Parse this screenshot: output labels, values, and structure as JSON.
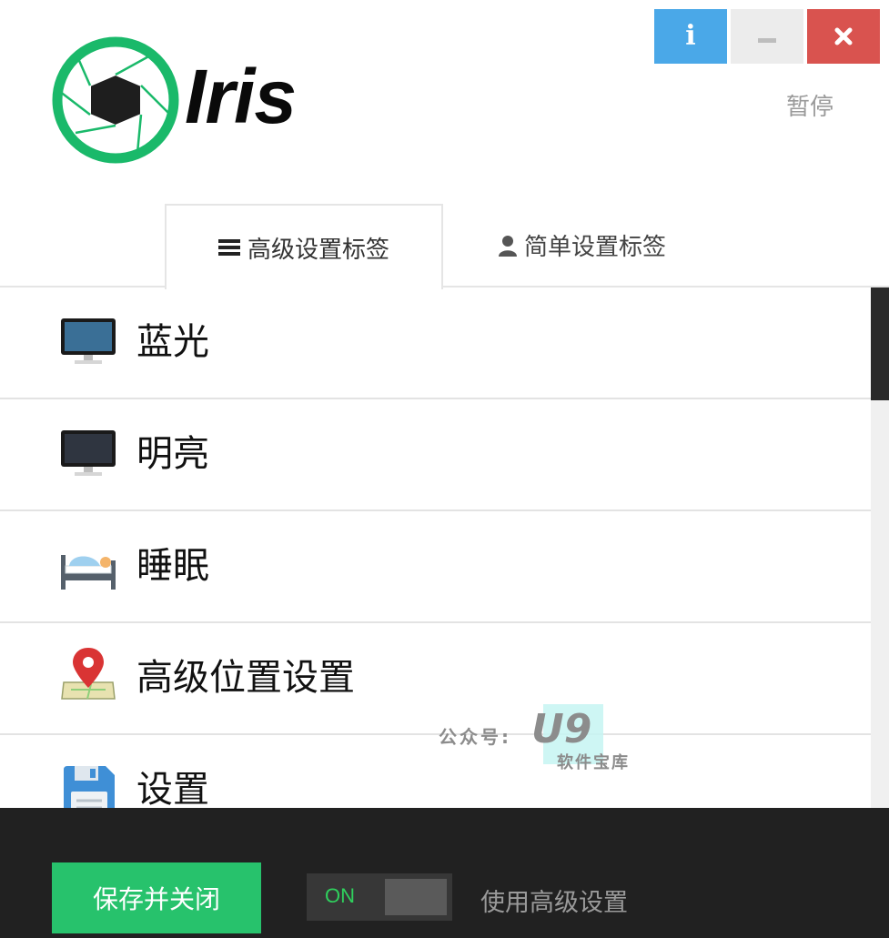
{
  "window": {
    "info_label": "i",
    "pause_label": "暂停"
  },
  "logo": {
    "text": "Iris",
    "ring_color": "#1ab96a"
  },
  "tabs": [
    {
      "label": "高级设置标签",
      "icon": "menu-icon",
      "active": true
    },
    {
      "label": "简单设置标签",
      "icon": "user-icon",
      "active": false
    }
  ],
  "settings_items": [
    {
      "label": "蓝光",
      "icon": "monitor-blue-icon"
    },
    {
      "label": "明亮",
      "icon": "monitor-dark-icon"
    },
    {
      "label": "睡眠",
      "icon": "bed-icon"
    },
    {
      "label": "高级位置设置",
      "icon": "map-pin-icon"
    },
    {
      "label": "设置",
      "icon": "floppy-disk-icon"
    }
  ],
  "watermark": {
    "prefix": "公众号:",
    "brand": "U9",
    "sub": "软件宝库"
  },
  "footer": {
    "save_label": "保存并关闭",
    "toggle_state": "ON",
    "advanced_label": "使用高级设置"
  },
  "colors": {
    "info": "#4aa8e8",
    "close": "#d9534f",
    "save": "#27c26c",
    "footer_bg": "#212121"
  }
}
